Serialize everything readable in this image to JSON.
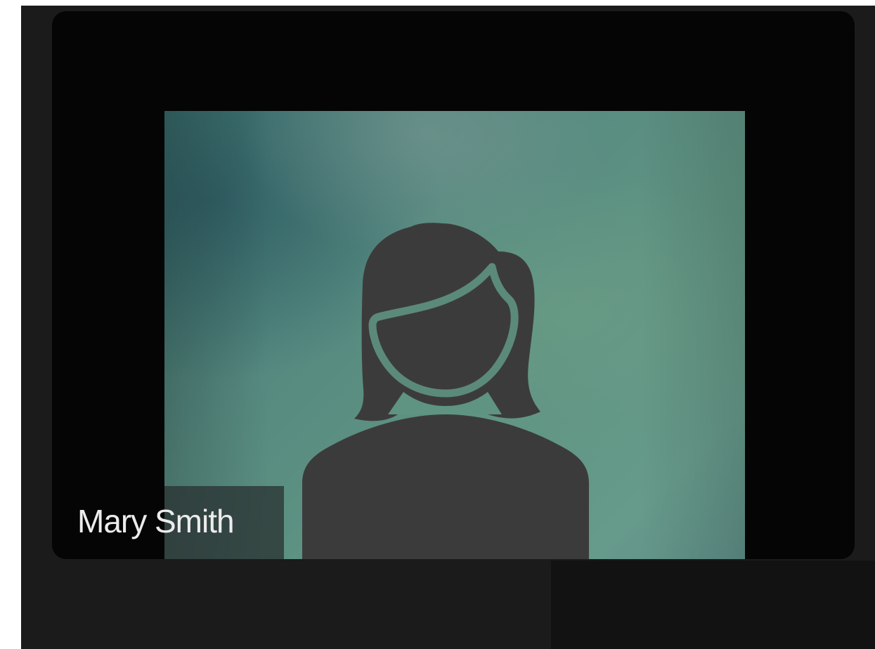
{
  "participant": {
    "name": "Mary Smith",
    "video_state": "camera-off",
    "avatar_icon": "female-user-silhouette-icon"
  },
  "colors": {
    "app_background": "#1b1b1b",
    "tile_background": "#050505",
    "feed_tint": "#5f9382",
    "avatar_fill": "#3c3b3b",
    "name_text": "#ececec"
  }
}
